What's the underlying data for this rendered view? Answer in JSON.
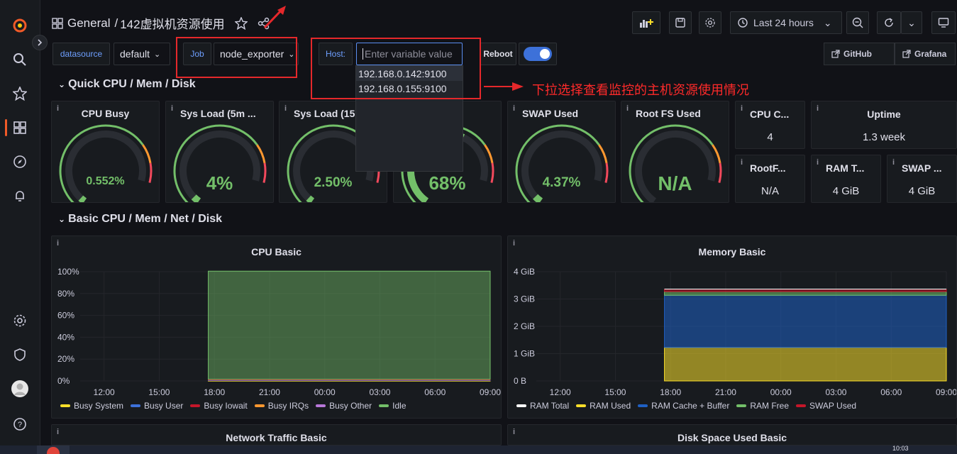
{
  "colors": {
    "green": "#73bf69",
    "yellow": "#fade2a",
    "red": "#f2495c",
    "blue": "#3d71d9",
    "orange": "#ff9830",
    "purple": "#b877d9",
    "annotation_red": "#e5282b"
  },
  "sidebar": {
    "icons": [
      "grafana-logo-icon",
      "search-icon",
      "star-icon",
      "dashboards-icon",
      "explore-icon",
      "alerting-icon",
      "gear-icon",
      "shield-icon",
      "avatar",
      "help-icon"
    ]
  },
  "header": {
    "folder": "General",
    "separator": "/",
    "title": "142虚拟机资源使用",
    "time_range": "Last 24 hours"
  },
  "variables": {
    "datasource_label": "datasource",
    "datasource_value": "default",
    "job_label": "Job",
    "job_value": "node_exporter",
    "host_label": "Host:",
    "host_placeholder": "Enter variable value",
    "reboot_label": "Reboot",
    "host_options": [
      "192.168.0.142:9100",
      "192.168.0.155:9100"
    ]
  },
  "links": {
    "github": "GitHub",
    "grafana": "Grafana"
  },
  "annotation": {
    "text": "下拉选择查看监控的主机资源使用情况"
  },
  "rows": {
    "quick": "Quick CPU / Mem / Disk",
    "basic": "Basic CPU / Mem / Net / Disk"
  },
  "gauges": [
    {
      "title": "CPU Busy",
      "value": "0.552%",
      "level": 0.00552
    },
    {
      "title": "Sys Load (5m ...",
      "value": "4%",
      "level": 0.04
    },
    {
      "title": "Sys Load (15r",
      "value": "2.50%",
      "level": 0.025
    },
    {
      "title": "ed",
      "value": "68%",
      "level": 0.68
    },
    {
      "title": "SWAP Used",
      "value": "4.37%",
      "level": 0.0437
    },
    {
      "title": "Root FS Used",
      "value": "N/A",
      "level": 0
    }
  ],
  "stats": [
    {
      "title": "CPU C...",
      "value": "4"
    },
    {
      "title": "Uptime",
      "value": "1.3 week"
    },
    {
      "title": "RootF...",
      "value": "N/A"
    },
    {
      "title": "RAM T...",
      "value": "4 GiB"
    },
    {
      "title": "SWAP ...",
      "value": "4 GiB"
    }
  ],
  "panels": {
    "cpu_basic": "CPU Basic",
    "memory_basic": "Memory Basic",
    "network": "Network Traffic Basic",
    "disk": "Disk Space Used Basic",
    "info": "i"
  },
  "chart_data": [
    {
      "type": "area",
      "title": "CPU Basic",
      "x_ticks": [
        "12:00",
        "15:00",
        "18:00",
        "21:00",
        "00:00",
        "03:00",
        "06:00",
        "09:00"
      ],
      "y_ticks": [
        "100%",
        "80%",
        "60%",
        "40%",
        "20%",
        "0%"
      ],
      "ylim": [
        0,
        100
      ],
      "data_start": "17:40",
      "series": [
        {
          "name": "Busy System",
          "color": "#fade2a",
          "values": [
            0.5
          ]
        },
        {
          "name": "Busy User",
          "color": "#3d71d9",
          "values": [
            0.5
          ]
        },
        {
          "name": "Busy Iowait",
          "color": "#c4162a",
          "values": [
            0.5
          ]
        },
        {
          "name": "Busy IRQs",
          "color": "#ff9830",
          "values": [
            0
          ]
        },
        {
          "name": "Busy Other",
          "color": "#b877d9",
          "values": [
            0
          ]
        },
        {
          "name": "Idle",
          "color": "#73bf69",
          "values": [
            99
          ]
        }
      ]
    },
    {
      "type": "area",
      "title": "Memory Basic",
      "x_ticks": [
        "12:00",
        "15:00",
        "18:00",
        "21:00",
        "00:00",
        "03:00",
        "06:00",
        "09:00"
      ],
      "y_ticks": [
        "4 GiB",
        "3 GiB",
        "2 GiB",
        "1 GiB",
        "0 B"
      ],
      "ylim": [
        0,
        4.4
      ],
      "data_start": "17:40",
      "series": [
        {
          "name": "RAM Total",
          "color": "#ffffff",
          "values": [
            3.7
          ]
        },
        {
          "name": "RAM Used",
          "color": "#fade2a",
          "values": [
            1.35
          ]
        },
        {
          "name": "RAM Cache + Buffer",
          "color": "#1f60c4",
          "values": [
            2.1
          ]
        },
        {
          "name": "RAM Free",
          "color": "#73bf69",
          "values": [
            0.15
          ]
        },
        {
          "name": "SWAP Used",
          "color": "#c4162a",
          "values": [
            0.1
          ]
        }
      ]
    }
  ],
  "taskbar": {
    "clock": "10:03"
  }
}
